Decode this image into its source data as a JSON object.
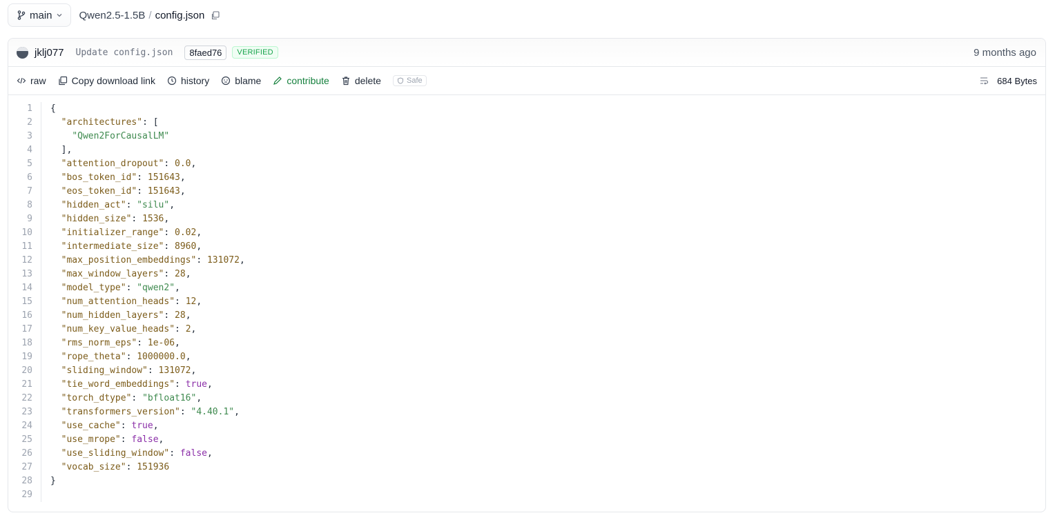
{
  "topbar": {
    "branch_label": "main",
    "branch_icon": "git-branch-icon",
    "repo": "Qwen2.5-1.5B",
    "separator": "/",
    "file": "config.json",
    "copy_icon": "copy-icon"
  },
  "commit": {
    "author": "jklj077",
    "message": "Update config.json",
    "sha": "8faed76",
    "verified": "VERIFIED",
    "time": "9 months ago"
  },
  "actions": {
    "raw": "raw",
    "copy_link": "Copy download link",
    "history": "history",
    "blame": "blame",
    "contribute": "contribute",
    "delete": "delete",
    "safe": "Safe",
    "size": "684 Bytes"
  },
  "colors": {
    "key": "#7c5c1a",
    "string": "#3f8a4f",
    "number": "#7c5c1a",
    "boolean": "#8b2fa8",
    "verified": "#16a34a",
    "contribute": "#15803d"
  },
  "code_lines": [
    [
      [
        "p",
        "{"
      ]
    ],
    [
      [
        "p",
        "  "
      ],
      [
        "k",
        "\"architectures\""
      ],
      [
        "p",
        ": ["
      ]
    ],
    [
      [
        "p",
        "    "
      ],
      [
        "s",
        "\"Qwen2ForCausalLM\""
      ]
    ],
    [
      [
        "p",
        "  ],"
      ]
    ],
    [
      [
        "p",
        "  "
      ],
      [
        "k",
        "\"attention_dropout\""
      ],
      [
        "p",
        ": "
      ],
      [
        "n",
        "0.0"
      ],
      [
        "p",
        ","
      ]
    ],
    [
      [
        "p",
        "  "
      ],
      [
        "k",
        "\"bos_token_id\""
      ],
      [
        "p",
        ": "
      ],
      [
        "n",
        "151643"
      ],
      [
        "p",
        ","
      ]
    ],
    [
      [
        "p",
        "  "
      ],
      [
        "k",
        "\"eos_token_id\""
      ],
      [
        "p",
        ": "
      ],
      [
        "n",
        "151643"
      ],
      [
        "p",
        ","
      ]
    ],
    [
      [
        "p",
        "  "
      ],
      [
        "k",
        "\"hidden_act\""
      ],
      [
        "p",
        ": "
      ],
      [
        "s",
        "\"silu\""
      ],
      [
        "p",
        ","
      ]
    ],
    [
      [
        "p",
        "  "
      ],
      [
        "k",
        "\"hidden_size\""
      ],
      [
        "p",
        ": "
      ],
      [
        "n",
        "1536"
      ],
      [
        "p",
        ","
      ]
    ],
    [
      [
        "p",
        "  "
      ],
      [
        "k",
        "\"initializer_range\""
      ],
      [
        "p",
        ": "
      ],
      [
        "n",
        "0.02"
      ],
      [
        "p",
        ","
      ]
    ],
    [
      [
        "p",
        "  "
      ],
      [
        "k",
        "\"intermediate_size\""
      ],
      [
        "p",
        ": "
      ],
      [
        "n",
        "8960"
      ],
      [
        "p",
        ","
      ]
    ],
    [
      [
        "p",
        "  "
      ],
      [
        "k",
        "\"max_position_embeddings\""
      ],
      [
        "p",
        ": "
      ],
      [
        "n",
        "131072"
      ],
      [
        "p",
        ","
      ]
    ],
    [
      [
        "p",
        "  "
      ],
      [
        "k",
        "\"max_window_layers\""
      ],
      [
        "p",
        ": "
      ],
      [
        "n",
        "28"
      ],
      [
        "p",
        ","
      ]
    ],
    [
      [
        "p",
        "  "
      ],
      [
        "k",
        "\"model_type\""
      ],
      [
        "p",
        ": "
      ],
      [
        "s",
        "\"qwen2\""
      ],
      [
        "p",
        ","
      ]
    ],
    [
      [
        "p",
        "  "
      ],
      [
        "k",
        "\"num_attention_heads\""
      ],
      [
        "p",
        ": "
      ],
      [
        "n",
        "12"
      ],
      [
        "p",
        ","
      ]
    ],
    [
      [
        "p",
        "  "
      ],
      [
        "k",
        "\"num_hidden_layers\""
      ],
      [
        "p",
        ": "
      ],
      [
        "n",
        "28"
      ],
      [
        "p",
        ","
      ]
    ],
    [
      [
        "p",
        "  "
      ],
      [
        "k",
        "\"num_key_value_heads\""
      ],
      [
        "p",
        ": "
      ],
      [
        "n",
        "2"
      ],
      [
        "p",
        ","
      ]
    ],
    [
      [
        "p",
        "  "
      ],
      [
        "k",
        "\"rms_norm_eps\""
      ],
      [
        "p",
        ": "
      ],
      [
        "n",
        "1e-06"
      ],
      [
        "p",
        ","
      ]
    ],
    [
      [
        "p",
        "  "
      ],
      [
        "k",
        "\"rope_theta\""
      ],
      [
        "p",
        ": "
      ],
      [
        "n",
        "1000000.0"
      ],
      [
        "p",
        ","
      ]
    ],
    [
      [
        "p",
        "  "
      ],
      [
        "k",
        "\"sliding_window\""
      ],
      [
        "p",
        ": "
      ],
      [
        "n",
        "131072"
      ],
      [
        "p",
        ","
      ]
    ],
    [
      [
        "p",
        "  "
      ],
      [
        "k",
        "\"tie_word_embeddings\""
      ],
      [
        "p",
        ": "
      ],
      [
        "b",
        "true"
      ],
      [
        "p",
        ","
      ]
    ],
    [
      [
        "p",
        "  "
      ],
      [
        "k",
        "\"torch_dtype\""
      ],
      [
        "p",
        ": "
      ],
      [
        "s",
        "\"bfloat16\""
      ],
      [
        "p",
        ","
      ]
    ],
    [
      [
        "p",
        "  "
      ],
      [
        "k",
        "\"transformers_version\""
      ],
      [
        "p",
        ": "
      ],
      [
        "s",
        "\"4.40.1\""
      ],
      [
        "p",
        ","
      ]
    ],
    [
      [
        "p",
        "  "
      ],
      [
        "k",
        "\"use_cache\""
      ],
      [
        "p",
        ": "
      ],
      [
        "b",
        "true"
      ],
      [
        "p",
        ","
      ]
    ],
    [
      [
        "p",
        "  "
      ],
      [
        "k",
        "\"use_mrope\""
      ],
      [
        "p",
        ": "
      ],
      [
        "b",
        "false"
      ],
      [
        "p",
        ","
      ]
    ],
    [
      [
        "p",
        "  "
      ],
      [
        "k",
        "\"use_sliding_window\""
      ],
      [
        "p",
        ": "
      ],
      [
        "b",
        "false"
      ],
      [
        "p",
        ","
      ]
    ],
    [
      [
        "p",
        "  "
      ],
      [
        "k",
        "\"vocab_size\""
      ],
      [
        "p",
        ": "
      ],
      [
        "n",
        "151936"
      ]
    ],
    [
      [
        "p",
        "}"
      ]
    ],
    []
  ]
}
